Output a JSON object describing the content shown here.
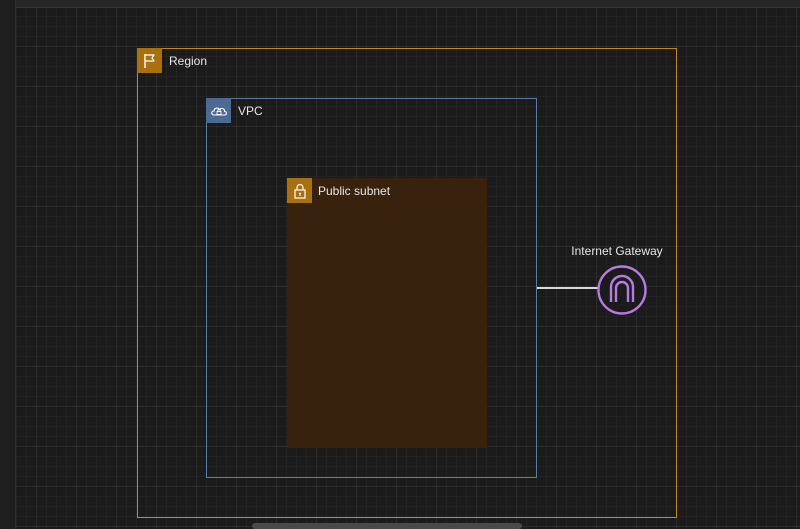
{
  "diagram": {
    "region": {
      "label": "Region",
      "icon": "flag-icon",
      "color": "#c28a1e"
    },
    "vpc": {
      "label": "VPC",
      "icon": "cloud-lock-icon",
      "color": "#5a7ba6"
    },
    "subnet": {
      "label": "Public subnet",
      "icon": "padlock-icon",
      "color": "#a8700f",
      "fill": "#38220d"
    },
    "internet_gateway": {
      "label": "Internet Gateway",
      "icon": "internet-gateway-icon",
      "color": "#b57be0"
    }
  }
}
